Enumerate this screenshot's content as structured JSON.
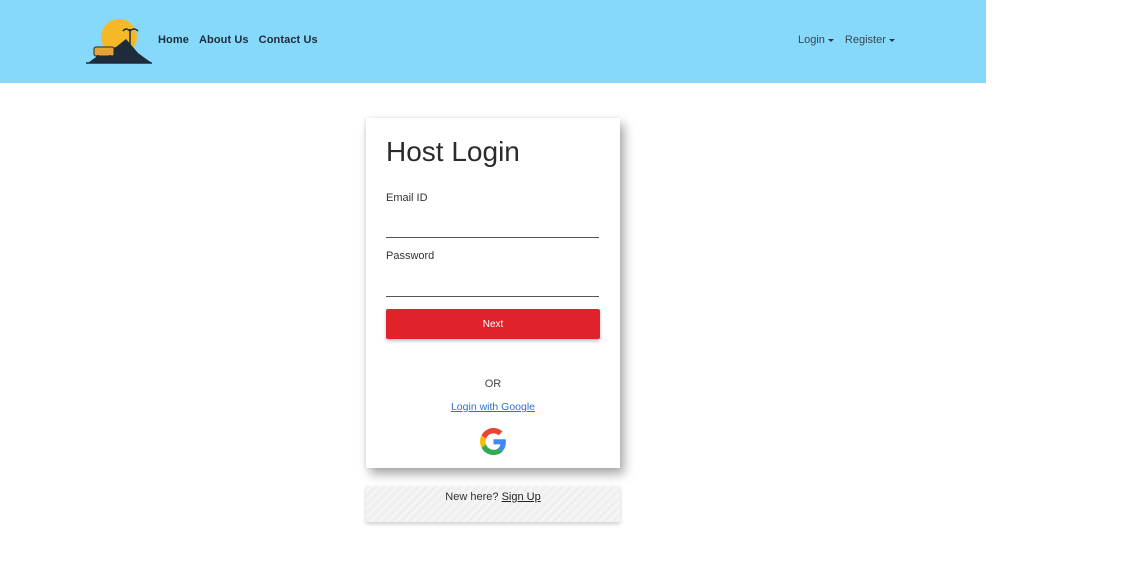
{
  "nav": {
    "links": [
      "Home",
      "About Us",
      "Contact Us"
    ],
    "login_label": "Login",
    "register_label": "Register",
    "background_color": "#87d9fb"
  },
  "card": {
    "title": "Host Login",
    "email_label": "Email ID",
    "email_value": "",
    "password_label": "Password",
    "password_value": "",
    "next_label": "Next",
    "or_text": "OR",
    "google_link": "Login with Google"
  },
  "signup": {
    "prompt": "New here?",
    "link": "Sign Up"
  },
  "colors": {
    "accent_button": "#e0232b",
    "link": "#2f6fd6"
  },
  "icons": [
    "logo-icon",
    "google-icon",
    "caret-down-icon"
  ]
}
